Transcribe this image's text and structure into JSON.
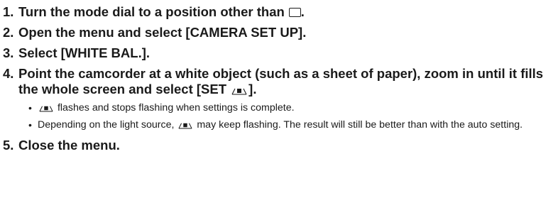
{
  "steps": [
    {
      "number": "1.",
      "text_before_icon": "Turn the mode dial to a position other than",
      "icon": "auto-mode-rectangle-icon",
      "text_after_icon": "."
    },
    {
      "number": "2.",
      "text": "Open the menu and select [CAMERA SET UP]."
    },
    {
      "number": "3.",
      "text": "Select [WHITE BAL.]."
    },
    {
      "number": "4.",
      "text_before_icon": "Point the camcorder at a white object (such as a sheet of paper), zoom in until it fills the whole screen and select [SET",
      "icon": "custom-white-balance-icon",
      "text_after_icon": "].",
      "notes": [
        {
          "text_before_icon": "",
          "icon": "custom-white-balance-icon",
          "text_after_icon": "flashes and stops flashing when settings is complete."
        },
        {
          "text_before_icon": "Depending on the light source,",
          "icon": "custom-white-balance-icon",
          "text_after_icon": "may keep flashing. The result will still be better than with the auto setting."
        }
      ]
    },
    {
      "number": "5.",
      "text": "Close the menu."
    }
  ]
}
